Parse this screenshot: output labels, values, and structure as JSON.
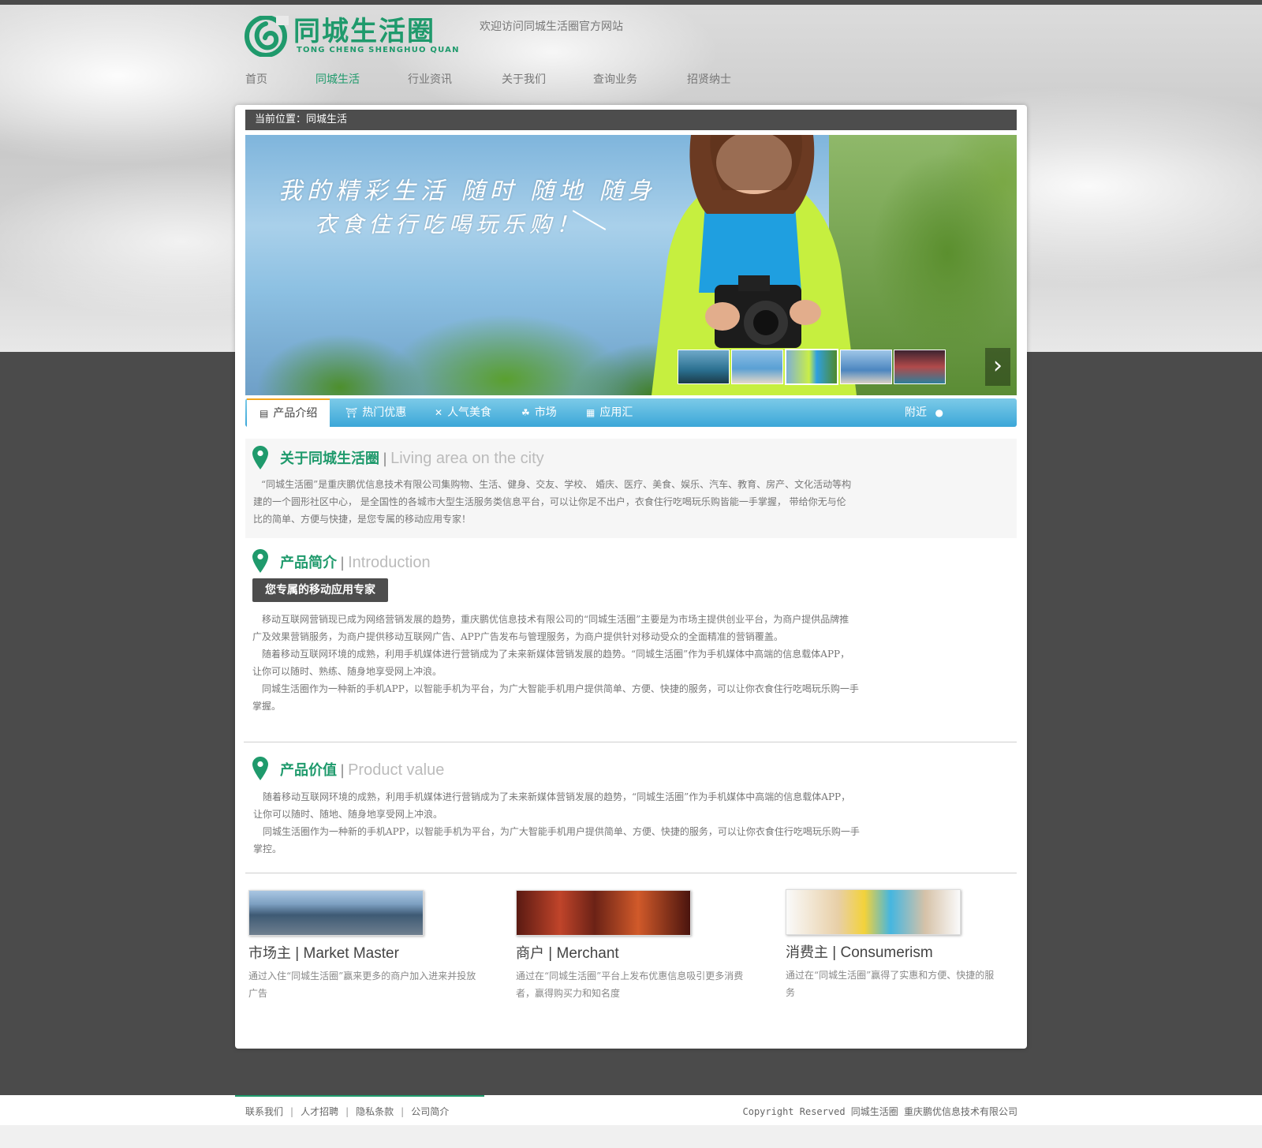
{
  "site": {
    "logo_cn": "同城生活圈",
    "logo_en": "TONG CHENG SHENGHUO QUAN",
    "welcome": "欢迎访问同城生活圈官方网站"
  },
  "nav": {
    "items": [
      {
        "label": "首页",
        "active": false
      },
      {
        "label": "同城生活",
        "active": true
      },
      {
        "label": "行业资讯",
        "active": false
      },
      {
        "label": "关于我们",
        "active": false
      },
      {
        "label": "查询业务",
        "active": false
      },
      {
        "label": "招贤纳士",
        "active": false
      }
    ]
  },
  "breadcrumb": "当前位置：同城生活",
  "banner": {
    "line1": "我的精彩生活 随时 随地 随身",
    "line2": "衣食住行吃喝玩乐购！",
    "active_thumb": 3,
    "next_icon": "chevron-right-icon"
  },
  "tabs": {
    "items": [
      {
        "label": "产品介绍",
        "icon": "book-icon",
        "active": true
      },
      {
        "label": "热门优惠",
        "icon": "basket-icon",
        "active": false
      },
      {
        "label": "人气美食",
        "icon": "cutlery-icon",
        "active": false
      },
      {
        "label": "市场",
        "icon": "cart-icon",
        "active": false
      },
      {
        "label": "应用汇",
        "icon": "calendar-icon",
        "active": false
      }
    ],
    "nearby": {
      "label": "附近",
      "icon": "map-marker-icon"
    }
  },
  "about": {
    "title_cn": "关于同城生活圈",
    "title_en": "Living area on the city",
    "text": [
      "“同城生活圈”是重庆鹏优信息技术有限公司集购物、生活、健身、交友、学校、 婚庆、医疗、美食、娱乐、汽车、教育、房产、文化活动等构",
      "建的一个圆形社区中心，  是全国性的各城市大型生活服务类信息平台，可以让你足不出户，衣食住行吃喝玩乐购皆能一手掌握，  带给你无与伦",
      "比的简单、方便与快捷，是您专属的移动应用专家！"
    ]
  },
  "intro": {
    "title_cn": "产品简介",
    "title_en": "Introduction",
    "tag": "您专属的移动应用专家",
    "text": [
      "移动互联网营销现已成为网络营销发展的趋势，重庆鹏优信息技术有限公司的“同城生活圈”主要是为市场主提供创业平台，为商户提供品牌推",
      "广及效果营销服务，为商户提供移动互联网广告、APP广告发布与管理服务，为商户提供针对移动受众的全面精准的营销覆盖。",
      "随着移动互联网环境的成熟，利用手机媒体进行营销成为了未来新媒体营销发展的趋势。“同城生活圈”作为手机媒体中高端的信息载体APP，",
      "让你可以随时、熟练、随身地享受网上冲浪。",
      "同城生活圈作为一种新的手机APP，以智能手机为平台，为广大智能手机用户提供简单、方便、快捷的服务，可以让你衣食住行吃喝玩乐购一手",
      "掌握。"
    ]
  },
  "value": {
    "title_cn": "产品价值",
    "title_en": "Product value",
    "text": [
      "随着移动互联网环境的成熟，利用手机媒体进行营销成为了未来新媒体营销发展的趋势，“同城生活圈”作为手机媒体中高端的信息载体APP，",
      "让你可以随时、随地、随身地享受网上冲浪。",
      "同城生活圈作为一种新的手机APP，以智能手机为平台，为广大智能手机用户提供简单、方便、快捷的服务，可以让你衣食住行吃喝玩乐购一手",
      "掌控。"
    ]
  },
  "features": [
    {
      "title_cn": "市场主",
      "title_en": "Market Master",
      "desc": "通过入住“同城生活圈”赢来更多的商户加入进来并投放广告"
    },
    {
      "title_cn": "商户",
      "title_en": "Merchant",
      "desc": "通过在“同城生活圈”平台上发布优惠信息吸引更多消费者，赢得购买力和知名度"
    },
    {
      "title_cn": "消费主",
      "title_en": "Consumerism",
      "desc": "通过在“同城生活圈”赢得了实惠和方便、快捷的服务"
    }
  ],
  "footer": {
    "links": [
      "联系我们",
      "人才招聘",
      "隐私条款",
      "公司简介"
    ],
    "copyright": "Copyright Reserved 同城生活圈  重庆鹏优信息技术有限公司"
  },
  "colors": {
    "brand": "#1f9a6c",
    "tab_bar": "#3ba7d8",
    "accent": "#f2a51b",
    "dark": "#4d4d4d"
  }
}
